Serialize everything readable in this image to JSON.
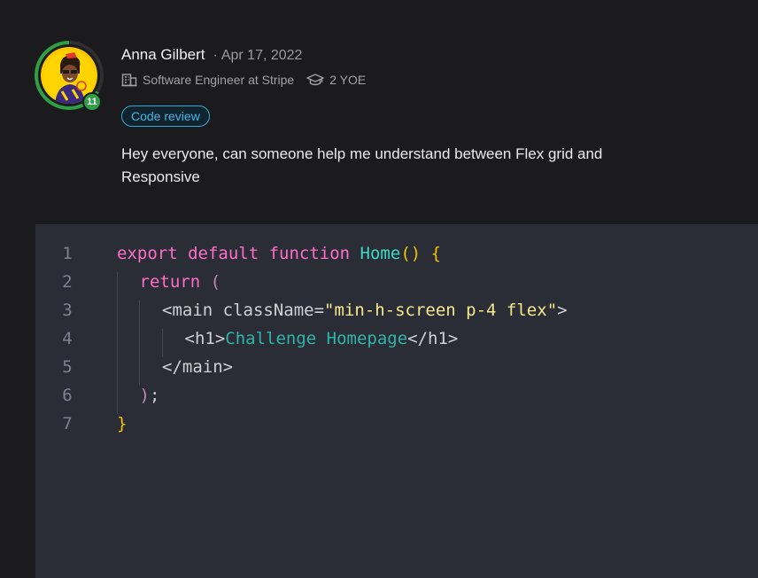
{
  "post": {
    "author": "Anna Gilbert",
    "separator": "·",
    "date": "Apr 17, 2022",
    "level": "11",
    "job": "Software Engineer at Stripe",
    "experience": "2 YOE",
    "tag": "Code review",
    "body": "Hey everyone, can someone help me understand between Flex grid and Responsive"
  },
  "icons": {
    "job": "building-icon",
    "experience": "graduation-cap-icon"
  },
  "colors": {
    "background": "#1b1b1d",
    "code_background": "#2a2c36",
    "level_badge": "#2f9e44",
    "tag_accent": "#38a8d9",
    "keyword": "#ff6ec7",
    "function_name": "#3fd7c5",
    "brace": "#f5c400",
    "string": "#f7e98e"
  },
  "code": {
    "lines": [
      {
        "n": "1",
        "t": [
          {
            "c": "kw",
            "v": "export default function "
          },
          {
            "c": "fn",
            "v": "Home"
          },
          {
            "c": "br",
            "v": "() {"
          }
        ]
      },
      {
        "n": "2",
        "t": [
          {
            "c": "kw",
            "v": "return "
          },
          {
            "c": "pr",
            "v": "("
          }
        ]
      },
      {
        "n": "3",
        "t": [
          {
            "c": "punct",
            "v": "<main className="
          },
          {
            "c": "str",
            "v": "\"min-h-screen p-4 flex\""
          },
          {
            "c": "punct",
            "v": ">"
          }
        ]
      },
      {
        "n": "4",
        "t": [
          {
            "c": "punct",
            "v": "<h1>"
          },
          {
            "c": "txt",
            "v": "Challenge Homepage"
          },
          {
            "c": "punct",
            "v": "</h1>"
          }
        ]
      },
      {
        "n": "5",
        "t": [
          {
            "c": "punct",
            "v": "</main>"
          }
        ]
      },
      {
        "n": "6",
        "t": [
          {
            "c": "pr",
            "v": ")"
          },
          {
            "c": "punct",
            "v": ";"
          }
        ]
      },
      {
        "n": "7",
        "t": [
          {
            "c": "br",
            "v": "}"
          }
        ]
      }
    ]
  }
}
